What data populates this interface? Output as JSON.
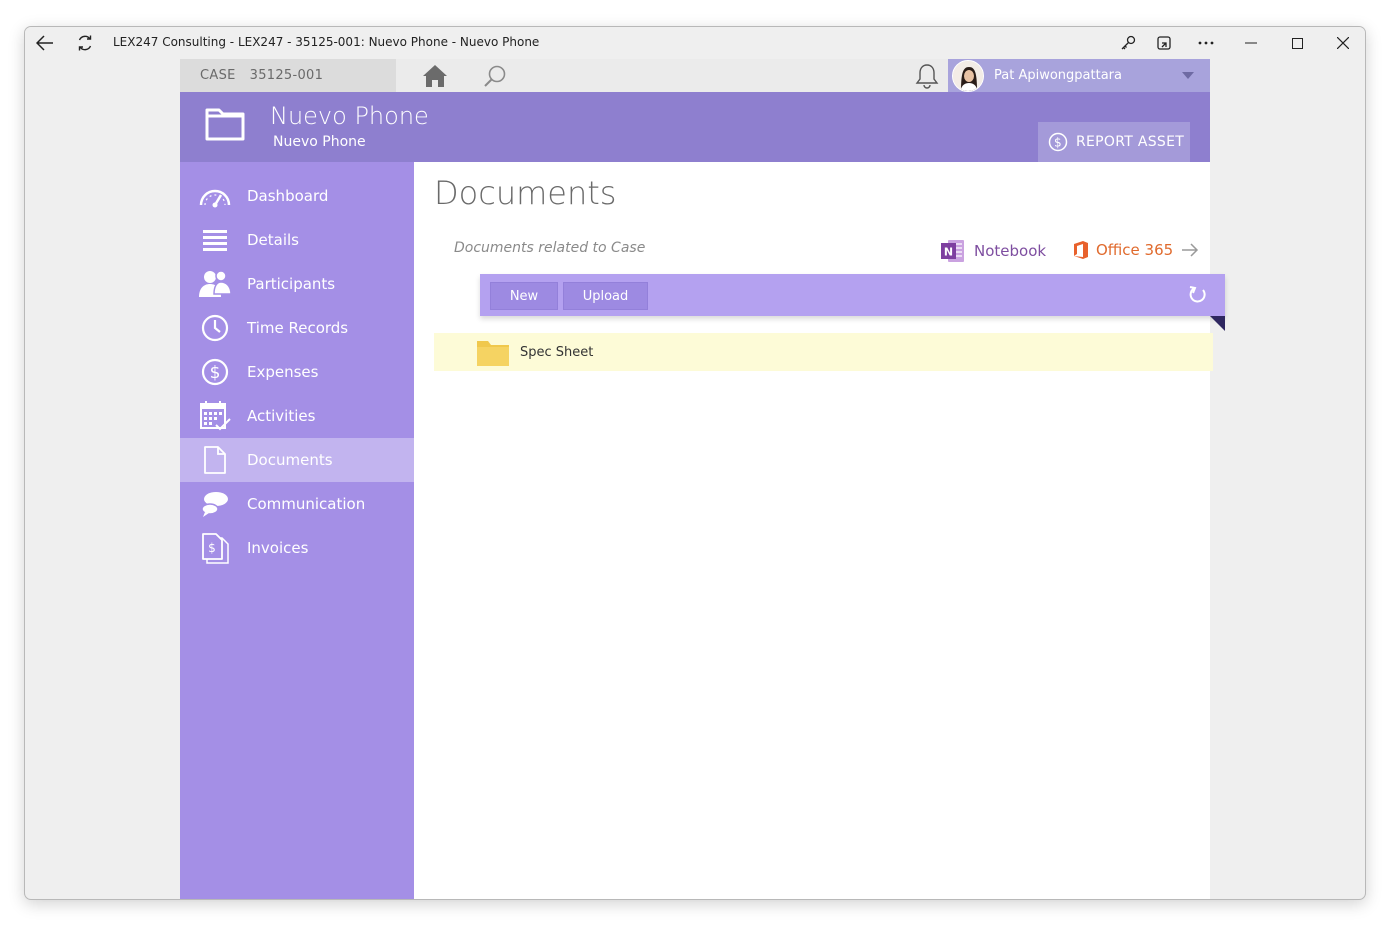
{
  "window": {
    "title": "LEX247 Consulting - LEX247 - 35125-001: Nuevo Phone - Nuevo Phone"
  },
  "topbar": {
    "case_label": "CASE",
    "case_number": "35125-001",
    "user_name": "Pat Apiwongpattara"
  },
  "header": {
    "title": "Nuevo Phone",
    "subtitle": "Nuevo Phone",
    "report_button": "REPORT ASSET"
  },
  "sidebar": {
    "items": [
      {
        "label": "Dashboard",
        "icon": "gauge-icon"
      },
      {
        "label": "Details",
        "icon": "list-icon"
      },
      {
        "label": "Participants",
        "icon": "people-icon"
      },
      {
        "label": "Time Records",
        "icon": "clock-icon"
      },
      {
        "label": "Expenses",
        "icon": "dollar-icon"
      },
      {
        "label": "Activities",
        "icon": "calendar-check-icon"
      },
      {
        "label": "Documents",
        "icon": "document-icon",
        "active": true
      },
      {
        "label": "Communication",
        "icon": "chat-icon"
      },
      {
        "label": "Invoices",
        "icon": "invoice-icon"
      }
    ]
  },
  "main": {
    "title": "Documents",
    "subtitle": "Documents related to Case",
    "notebook_label": "Notebook",
    "office_label": "Office 365",
    "toolbar": {
      "new_label": "New",
      "upload_label": "Upload"
    },
    "documents": [
      {
        "name": "Spec Sheet",
        "type": "folder"
      }
    ]
  },
  "colors": {
    "sidebar": "#a48fe6",
    "header": "#8e7fcf",
    "active_item": "#c2b4ef",
    "toolbar": "#b4a1f0",
    "row_highlight": "#fdfbd7",
    "notebook": "#7e4ea0",
    "office": "#e06a2d"
  }
}
